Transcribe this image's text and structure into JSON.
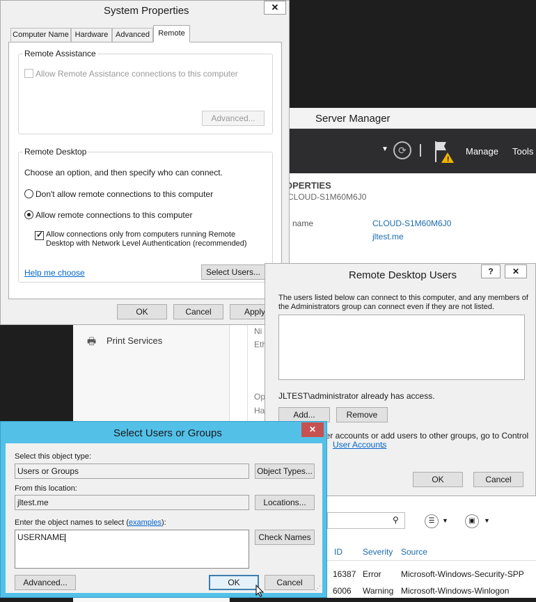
{
  "system_properties": {
    "title": "System Properties",
    "close_glyph": "✕",
    "tabs": [
      "Computer Name",
      "Hardware",
      "Advanced",
      "Remote"
    ],
    "remote_assistance": {
      "group_label": "Remote Assistance",
      "allow_label": "Allow Remote Assistance connections to this computer",
      "advanced_label": "Advanced..."
    },
    "remote_desktop": {
      "group_label": "Remote Desktop",
      "intro": "Choose an option, and then specify who can connect.",
      "dont_allow_label": "Don't allow remote connections to this computer",
      "allow_label": "Allow remote connections to this computer",
      "nla_line1": "Allow connections only from computers running Remote",
      "nla_line2": "Desktop with Network Level Authentication (recommended)",
      "help_link": "Help me choose",
      "select_users_label": "Select Users..."
    },
    "buttons": {
      "ok": "OK",
      "cancel": "Cancel",
      "apply": "Apply"
    }
  },
  "server_manager": {
    "title": "Server Manager",
    "manage_label": "Manage",
    "tools_label": "Tools",
    "properties_heading": "OPERTIES",
    "properties_sub": "CLOUD-S1M60M6J0",
    "name_label": "name",
    "computer_name": "CLOUD-S1M60M6J0",
    "domain": "jltest.me",
    "print_services": "Print Services",
    "ni": "Ni",
    "eth": "Eth",
    "op": "Op",
    "ha": "Ha",
    "events": {
      "headers": [
        "ID",
        "Severity",
        "Source"
      ],
      "rows": [
        [
          "16387",
          "Error",
          "Microsoft-Windows-Security-SPP"
        ],
        [
          "6006",
          "Warning",
          "Microsoft-Windows-Winlogon"
        ]
      ]
    }
  },
  "rdu": {
    "title": "Remote Desktop Users",
    "help_glyph": "?",
    "close_glyph": "✕",
    "desc_line1": "The users listed below can connect to this computer, and any members of",
    "desc_line2": "the Administrators group can connect even if they are not listed.",
    "already_access": "JLTEST\\administrator already has access.",
    "add_label": "Add...",
    "remove_label": "Remove",
    "info_line1": "user accounts or add users to other groups, go to Control",
    "info_link": "User Accounts",
    "info_end": ".",
    "ok": "OK",
    "cancel": "Cancel"
  },
  "sug": {
    "title": "Select Users or Groups",
    "close_glyph": "✕",
    "object_type_label": "Select this object type:",
    "object_type_value": "Users or Groups",
    "object_types_btn": "Object Types...",
    "location_label": "From this location:",
    "location_value": "jltest.me",
    "locations_btn": "Locations...",
    "names_label_pre": "Enter the object names to select (",
    "names_label_link": "examples",
    "names_label_post": "):",
    "names_value": "USERNAME",
    "check_names_btn": "Check Names",
    "advanced_btn": "Advanced...",
    "ok": "OK",
    "cancel": "Cancel"
  },
  "colors": {
    "sug_titlebar": "#53c0e8",
    "close_red": "#c75050",
    "sm_header": "#2d2d30",
    "link": "#0066cc"
  }
}
